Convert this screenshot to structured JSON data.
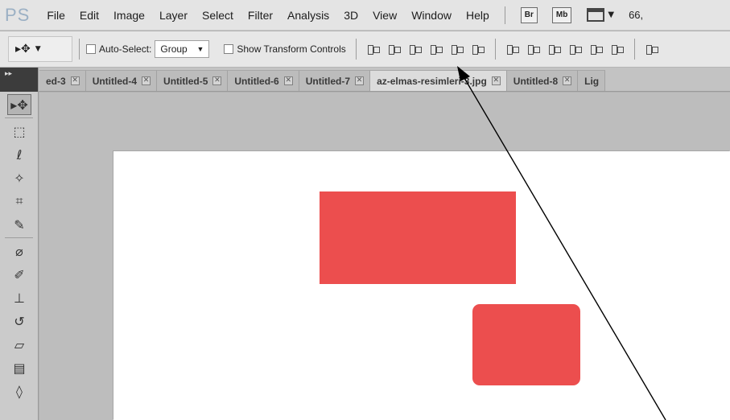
{
  "app": {
    "logo": "PS"
  },
  "menu": [
    "File",
    "Edit",
    "Image",
    "Layer",
    "Select",
    "Filter",
    "Analysis",
    "3D",
    "View",
    "Window",
    "Help"
  ],
  "bridge_badges": [
    "Br",
    "Mb"
  ],
  "zoom": "66,",
  "options": {
    "auto_select_label": "Auto-Select:",
    "auto_select_value": "Group",
    "show_transform_label": "Show Transform Controls"
  },
  "tabs": [
    {
      "label": "ed-3"
    },
    {
      "label": "Untitled-4"
    },
    {
      "label": "Untitled-5"
    },
    {
      "label": "Untitled-6"
    },
    {
      "label": "Untitled-7"
    },
    {
      "label": "az-elmas-resimleri-3.jpg"
    },
    {
      "label": "Untitled-8"
    },
    {
      "label": "Lig"
    }
  ],
  "tab_close_glyph": "✕",
  "canvas": {
    "shape_color": "#ec4e4e",
    "background": "#ffffff"
  },
  "icons": [
    "move-tool-icon",
    "marquee-icon",
    "lasso-icon",
    "magic-wand-icon",
    "crop-icon",
    "eyedropper-icon",
    "healing-brush-icon",
    "brush-icon",
    "clone-stamp-icon",
    "history-brush-icon",
    "eraser-icon",
    "gradient-icon",
    "blur-icon"
  ]
}
